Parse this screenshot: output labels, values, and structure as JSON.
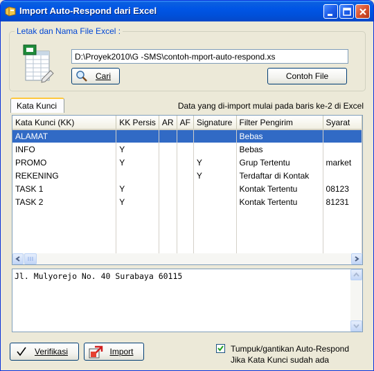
{
  "window": {
    "title": "Import Auto-Respond dari Excel"
  },
  "file_group": {
    "legend": "Letak dan Nama File Excel :",
    "path_value": "D:\\Proyek2010\\G -SMS\\contoh-mport-auto-respond.xs",
    "browse_label": "Cari",
    "sample_label": "Contoh File"
  },
  "tabs": {
    "active": "Kata Kunci"
  },
  "import_note": "Data yang di-import mulai pada baris ke-2 di Excel",
  "grid": {
    "columns": [
      "Kata Kunci (KK)",
      "KK Persis",
      "AR",
      "AF",
      "Signature",
      "Filter Pengirim",
      "Syarat"
    ],
    "rows": [
      [
        "ALAMAT",
        "",
        "",
        "",
        "",
        "Bebas",
        ""
      ],
      [
        "INFO",
        "Y",
        "",
        "",
        "",
        "Bebas",
        ""
      ],
      [
        "PROMO",
        "Y",
        "",
        "",
        "Y",
        "Grup Tertentu",
        "market"
      ],
      [
        "REKENING",
        "",
        "",
        "",
        "Y",
        "Terdaftar di Kontak",
        ""
      ],
      [
        "TASK 1",
        "Y",
        "",
        "",
        "",
        "Kontak Tertentu",
        "08123"
      ],
      [
        "TASK 2",
        "Y",
        "",
        "",
        "",
        "Kontak Tertentu",
        "81231"
      ]
    ],
    "selected_row": 0
  },
  "memo": {
    "text": "Jl. Mulyorejo No. 40 Surabaya 60115"
  },
  "footer": {
    "verify_label": "Verifikasi",
    "import_label": "Import",
    "overwrite_checked": true,
    "overwrite_line1": "Tumpuk/gantikan Auto-Respond",
    "overwrite_line2": "Jika Kata Kunci sudah ada"
  },
  "colors": {
    "titlebar": "#0055E5",
    "selection": "#316AC5",
    "legend_text": "#0046D5",
    "checkbox_tick": "#21A121"
  },
  "icons": {
    "title": "folder-app-icon",
    "file": "excel-sheet-icon",
    "browse": "magnifier-icon",
    "verify": "checkmark-icon",
    "import": "import-arrow-icon"
  }
}
